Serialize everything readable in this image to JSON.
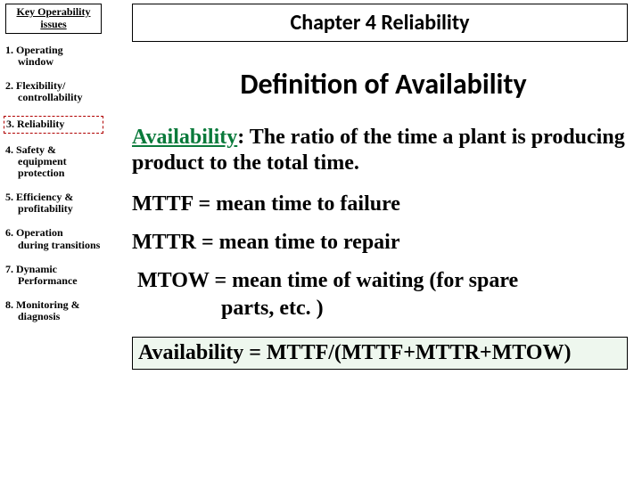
{
  "sidebar": {
    "title": "Key Operability issues",
    "items": [
      {
        "num": "1.",
        "first": "Operating",
        "rest": "window"
      },
      {
        "num": "2.",
        "first": "Flexibility/",
        "rest": "controllability"
      },
      {
        "num": "3.",
        "first": "Reliability",
        "rest": ""
      },
      {
        "num": "4.",
        "first": "Safety &",
        "rest": "equipment protection"
      },
      {
        "num": "5.",
        "first": "Efficiency &",
        "rest": "profitability"
      },
      {
        "num": "6.",
        "first": "Operation",
        "rest": "during transitions"
      },
      {
        "num": "7.",
        "first": "Dynamic",
        "rest": "Performance"
      },
      {
        "num": "8.",
        "first": "Monitoring &",
        "rest": "diagnosis"
      }
    ]
  },
  "main": {
    "chapter_label": "Chapter 4 Reliability",
    "heading": "Definition of Availability",
    "def_lead": "Availability",
    "def_rest": ": The ratio of the time a plant is producing product to the total time.",
    "mttf": "MTTF = mean time to failure",
    "mttr": "MTTR = mean time to repair",
    "mtow_a": "MTOW = mean time of waiting (for spare",
    "mtow_b": "parts, etc. )",
    "formula": "Availability = MTTF/(MTTF+MTTR+MTOW)"
  }
}
